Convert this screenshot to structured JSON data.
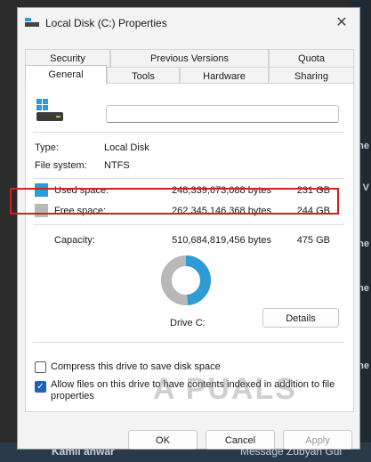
{
  "window": {
    "title": "Local Disk (C:) Properties",
    "close_glyph": "✕"
  },
  "tabs": {
    "row1": [
      "Security",
      "Previous Versions",
      "Quota"
    ],
    "row2": [
      "General",
      "Tools",
      "Hardware",
      "Sharing"
    ],
    "active": "General"
  },
  "general": {
    "name_value": "",
    "type_label": "Type:",
    "type_value": "Local Disk",
    "fs_label": "File system:",
    "fs_value": "NTFS",
    "used": {
      "label": "Used space:",
      "bytes": "248,339,673,088 bytes",
      "size": "231 GB",
      "color": "#2e9bd6"
    },
    "free": {
      "label": "Free space:",
      "bytes": "262,345,146,368 bytes",
      "size": "244 GB",
      "color": "#b8b8b8"
    },
    "capacity": {
      "label": "Capacity:",
      "bytes": "510,684,819,456 bytes",
      "size": "475 GB"
    },
    "drive_label": "Drive C:",
    "details_button": "Details",
    "used_fraction": 0.486
  },
  "options": {
    "compress": {
      "label": "Compress this drive to save disk space",
      "checked": false
    },
    "index": {
      "label_line1": "Allow files on this drive to have contents indexed in addition to file",
      "label_line2": "properties",
      "checked": true
    }
  },
  "buttons": {
    "ok": "OK",
    "cancel": "Cancel",
    "apply": "Apply"
  },
  "background": {
    "bottom_left": "Kamil anwar",
    "bottom_right": "Message Zubyan Gul"
  },
  "watermark": "A PUALS"
}
